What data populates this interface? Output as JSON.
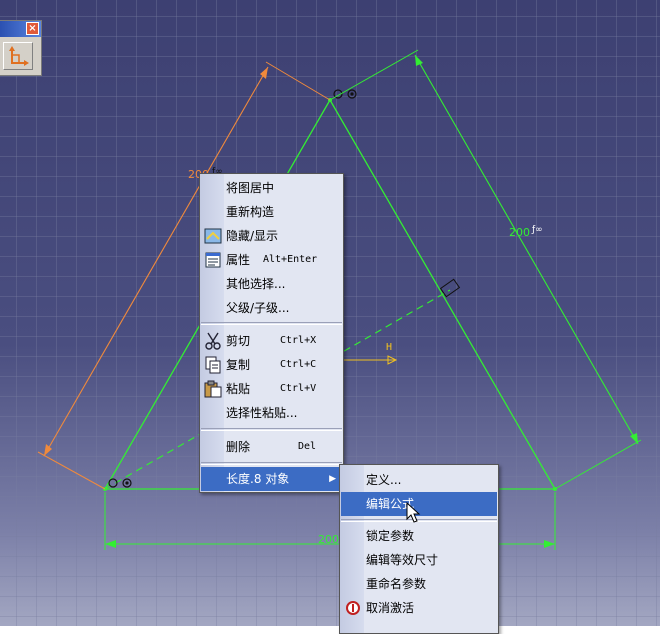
{
  "colors": {
    "background_top": "#3d4072",
    "sketch_line": "#33ee33",
    "dimension_orange": "#f08a3c",
    "menu_bg": "#e2e6f2",
    "menu_highlight": "#3c6cc4",
    "axis_h": "#f0c020"
  },
  "toolbar": {
    "close_glyph": "×",
    "button_icon": "sketch-axis-icon"
  },
  "sketch": {
    "dimensions": {
      "left_label": "200",
      "right_label": "200",
      "bottom_label": "200"
    },
    "axis_h_label": "H",
    "constraint_symbol": "ƒ∞"
  },
  "context_menu": {
    "items": [
      {
        "label": "将图居中",
        "shortcut": "",
        "icon": ""
      },
      {
        "label": "重新构造",
        "shortcut": "",
        "icon": ""
      },
      {
        "label": "隐藏/显示",
        "shortcut": "",
        "icon": "hide-show-icon"
      },
      {
        "label": "属性",
        "shortcut": "Alt+Enter",
        "icon": "properties-icon"
      },
      {
        "label": "其他选择...",
        "shortcut": "",
        "icon": ""
      },
      {
        "label": "父级/子级...",
        "shortcut": "",
        "icon": ""
      },
      {
        "label": "剪切",
        "shortcut": "Ctrl+X",
        "icon": "scissors-icon"
      },
      {
        "label": "复制",
        "shortcut": "Ctrl+C",
        "icon": "copy-icon"
      },
      {
        "label": "粘贴",
        "shortcut": "Ctrl+V",
        "icon": "paste-icon"
      },
      {
        "label": "选择性粘贴...",
        "shortcut": "",
        "icon": ""
      },
      {
        "label": "删除",
        "shortcut": "Del",
        "icon": ""
      },
      {
        "label": "长度.8 对象",
        "shortcut": "",
        "icon": "",
        "submenu_arrow": "▶"
      }
    ]
  },
  "submenu": {
    "items": [
      {
        "label": "定义...",
        "icon": ""
      },
      {
        "label": "编辑公式",
        "icon": ""
      },
      {
        "label": "锁定参数",
        "icon": ""
      },
      {
        "label": "编辑等效尺寸",
        "icon": ""
      },
      {
        "label": "重命名参数",
        "icon": ""
      },
      {
        "label": "取消激活",
        "icon": "deactivate-icon"
      }
    ]
  }
}
